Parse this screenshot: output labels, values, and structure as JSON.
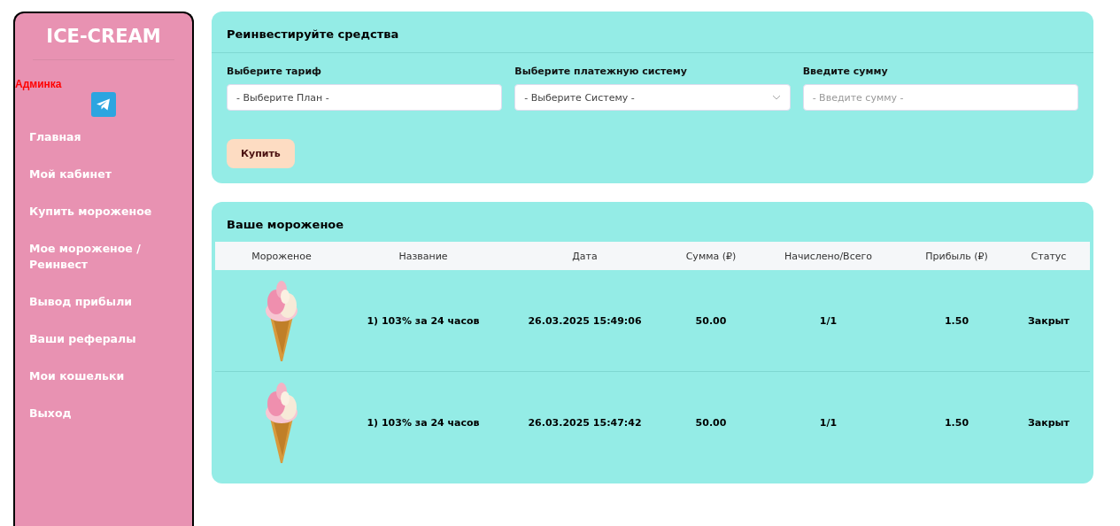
{
  "sidebar": {
    "logo": "ICE-CREAM",
    "admin_link": "Админка",
    "items": [
      {
        "label": "Главная"
      },
      {
        "label": "Мой кабинет"
      },
      {
        "label": "Купить мороженое"
      },
      {
        "label": "Мое мороженое / Реинвест"
      },
      {
        "label": "Вывод прибыли"
      },
      {
        "label": "Ваши рефералы"
      },
      {
        "label": "Мои кошельки"
      },
      {
        "label": "Выход"
      }
    ]
  },
  "reinvest": {
    "title": "Реинвестируйте средства",
    "fields": [
      {
        "label": "Выберите тариф",
        "value": "- Выберите План -",
        "dropdown": false
      },
      {
        "label": "Выберите платежную систему",
        "value": "- Выберите Систему -",
        "dropdown": true
      },
      {
        "label": "Введите сумму",
        "placeholder": "- Введите сумму -",
        "dropdown": false
      }
    ],
    "button": "Купить"
  },
  "orders": {
    "title": "Ваше мороженое",
    "columns": [
      "Мороженое",
      "Название",
      "Дата",
      "Сумма (₽)",
      "Начислено/Всего",
      "Прибыль (₽)",
      "Статус"
    ],
    "rows": [
      {
        "name": "1) 103% за 24 часов",
        "date": "26.03.2025 15:49:06",
        "amount": "50.00",
        "accrued": "1/1",
        "profit": "1.50",
        "status": "Закрыт"
      },
      {
        "name": "1) 103% за 24 часов",
        "date": "26.03.2025 15:47:42",
        "amount": "50.00",
        "accrued": "1/1",
        "profit": "1.50",
        "status": "Закрыт"
      }
    ]
  }
}
